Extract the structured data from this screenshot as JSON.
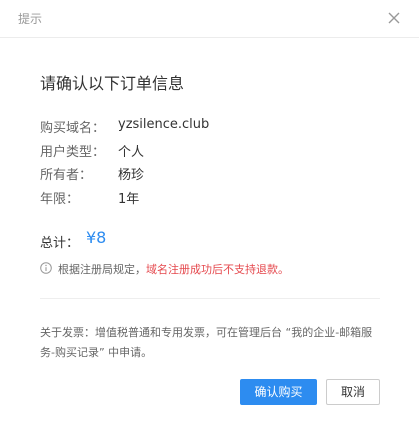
{
  "dialog": {
    "title": "提示"
  },
  "main_title": "请确认以下订单信息",
  "details": [
    {
      "label": "购买域名：",
      "value": "yzsilence.club"
    },
    {
      "label": "用户类型：",
      "value": "个人"
    },
    {
      "label": "所有者：",
      "value": "杨珍"
    },
    {
      "label": "年限：",
      "value": "1年"
    }
  ],
  "total": {
    "label": "总计：",
    "value": "¥8"
  },
  "notice": {
    "text": "根据注册局规定，",
    "warning": "域名注册成功后不支持退款。"
  },
  "invoice_text": "关于发票：增值税普通和专用发票，可在管理后台 “我的企业-邮箱服务-购买记录” 中申请。",
  "buttons": {
    "confirm": "确认购买",
    "cancel": "取消"
  },
  "colors": {
    "accent": "#2d8cf0",
    "warning": "#e5484d"
  }
}
